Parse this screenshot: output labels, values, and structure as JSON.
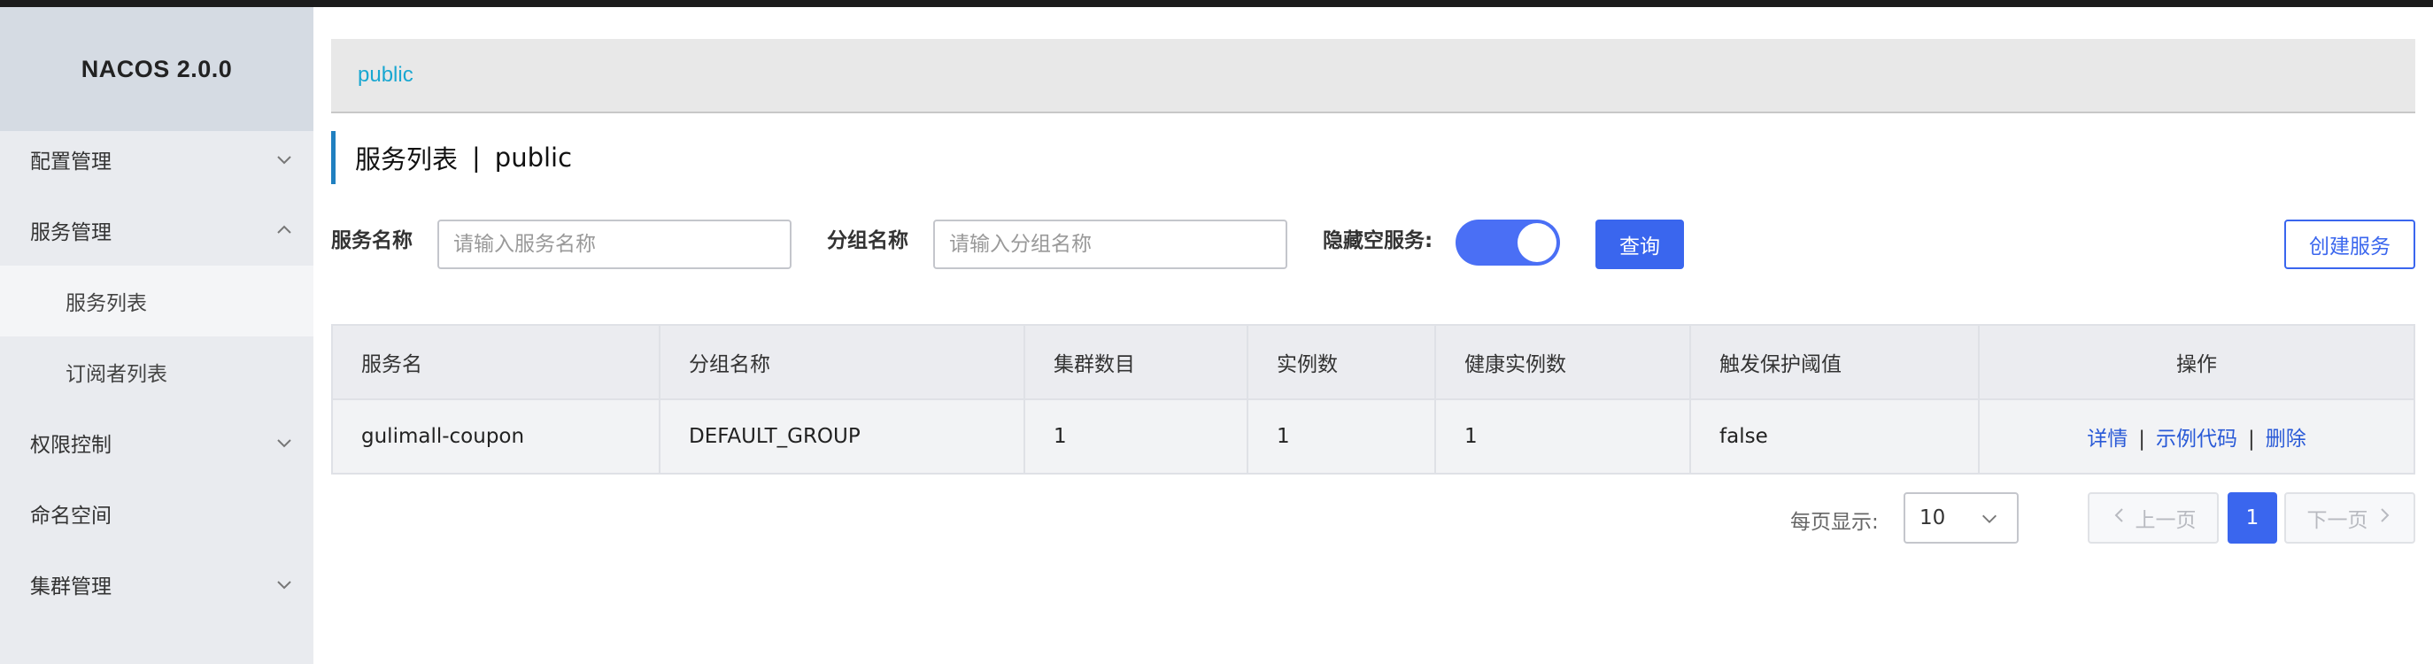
{
  "app": {
    "brand": "NACOS 2.0.0"
  },
  "sidebar": {
    "items": [
      {
        "label": "配置管理",
        "expanded": false
      },
      {
        "label": "服务管理",
        "expanded": true
      },
      {
        "label": "服务列表",
        "active": true
      },
      {
        "label": "订阅者列表"
      },
      {
        "label": "权限控制",
        "expanded": false
      },
      {
        "label": "命名空间"
      },
      {
        "label": "集群管理",
        "expanded": false
      }
    ]
  },
  "breadcrumb": {
    "namespace": "public"
  },
  "page": {
    "title": "服务列表",
    "separator": "|",
    "namespace": "public"
  },
  "filters": {
    "service_name_label": "服务名称",
    "service_name_placeholder": "请输入服务名称",
    "group_name_label": "分组名称",
    "group_name_placeholder": "请输入分组名称",
    "hide_empty_label": "隐藏空服务:",
    "hide_empty_on": true,
    "query_label": "查询",
    "create_label": "创建服务"
  },
  "table": {
    "headers": [
      "服务名",
      "分组名称",
      "集群数目",
      "实例数",
      "健康实例数",
      "触发保护阈值",
      "操作"
    ],
    "rows": [
      {
        "service": "gulimall-coupon",
        "group": "DEFAULT_GROUP",
        "clusters": "1",
        "instances": "1",
        "healthy": "1",
        "threshold": "false",
        "actions": [
          "详情",
          "示例代码",
          "删除"
        ],
        "action_separator": "|"
      }
    ]
  },
  "pagination": {
    "page_size_label": "每页显示:",
    "page_size": "10",
    "prev_label": "上一页",
    "current_page": "1",
    "next_label": "下一页"
  },
  "colors": {
    "accent": "#3a66ee",
    "link": "#2a5ad7",
    "breadcrumb": "#19a7d1",
    "sidebar_bg": "#e9ebef",
    "brand_bg": "#d5dbe3"
  }
}
